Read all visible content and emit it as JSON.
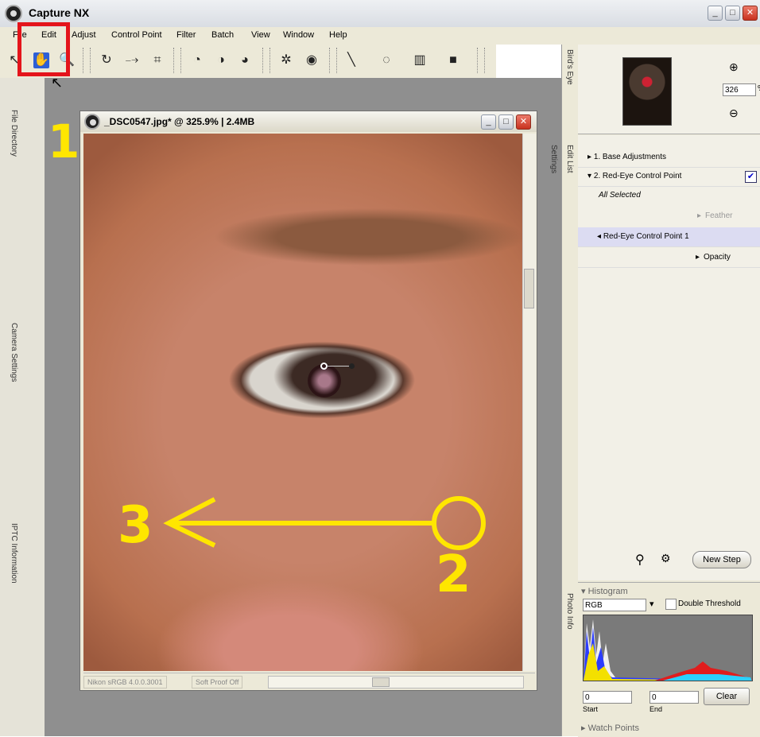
{
  "app": {
    "title": "Capture NX"
  },
  "menu": [
    "File",
    "Edit",
    "Adjust",
    "Control Point",
    "Filter",
    "Batch",
    "View",
    "Window",
    "Help"
  ],
  "left_sidebar": {
    "items": [
      "File Directory",
      "Camera Settings",
      "IPTC Information"
    ]
  },
  "image_window": {
    "title": "_DSC0547.jpg* @ 325.9% | 2.4MB",
    "status_profile": "Nikon sRGB 4.0.0.3001",
    "status_proof": "Soft Proof Off"
  },
  "right_panel": {
    "tabs": [
      "Bird's Eye",
      "Edit List",
      "Settings",
      "Photo Info"
    ],
    "zoom_value": "326",
    "zoom_unit": "%",
    "edit_list": {
      "step1": "1. Base Adjustments",
      "step2": "2. Red-Eye Control Point",
      "all_selected": "All Selected",
      "feather": "Feather",
      "control_point": "Red-Eye Control Point 1",
      "opacity": "Opacity",
      "new_step": "New Step"
    },
    "histogram": {
      "title": "Histogram",
      "channel": "RGB",
      "double_threshold": "Double Threshold",
      "start_value": "0",
      "end_value": "0",
      "start_label": "Start",
      "end_label": "End",
      "clear": "Clear",
      "watch_points": "Watch Points"
    }
  },
  "annotations": {
    "step1": "1",
    "step2": "2",
    "step3": "3"
  },
  "colors": {
    "annotation_yellow": "#ffe600",
    "highlight_red": "#e4141b"
  }
}
